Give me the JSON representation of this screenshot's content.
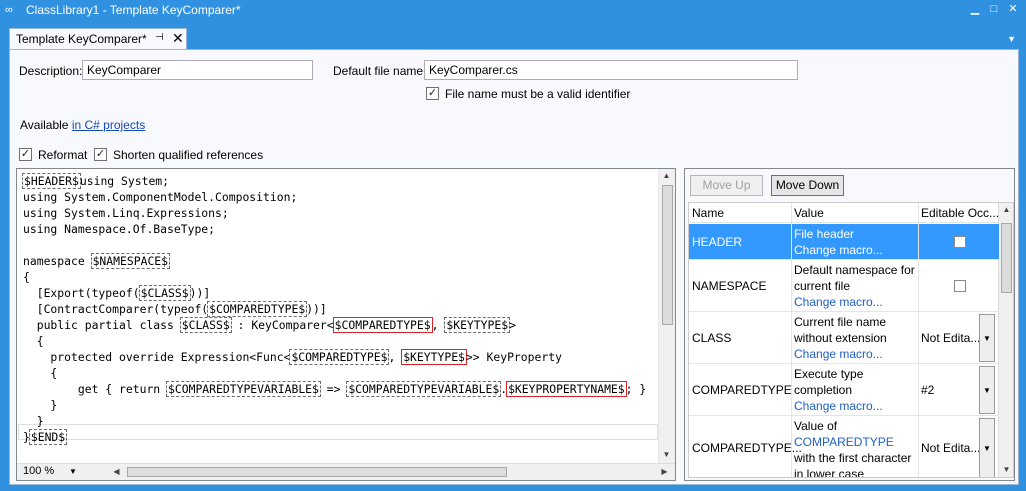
{
  "window": {
    "title": "ClassLibrary1 - Template KeyComparer*",
    "icon": "infinity-icon"
  },
  "tab": {
    "label": "Template KeyComparer*",
    "pin": "⊣",
    "close": "✕"
  },
  "form": {
    "description_label": "Description:",
    "description_value": "KeyComparer",
    "filename_label": "Default file name:",
    "filename_value": "KeyComparer.cs",
    "valid_identifier_label": "File name must be a valid identifier",
    "valid_identifier_checked": true,
    "available_prefix": "Available",
    "available_link": "in C# projects",
    "reformat_label": "Reformat",
    "reformat_checked": true,
    "shorten_label": "Shorten qualified references",
    "shorten_checked": true
  },
  "editor": {
    "zoom": "100 %",
    "code_lines": [
      "$HEADER$using System;",
      "using System.ComponentModel.Composition;",
      "using System.Linq.Expressions;",
      "using Namespace.Of.BaseType;",
      "",
      "namespace $NAMESPACE$",
      "{",
      "  [Export(typeof($CLASS$))]",
      "  [ContractComparer(typeof($COMPAREDTYPE$))]",
      "  public partial class $CLASS$ : KeyComparer<$COMPAREDTYPE$, $KEYTYPE$>",
      "  {",
      "    protected override Expression<Func<$COMPAREDTYPE$, $KEYTYPE$>> KeyProperty",
      "    {",
      "        get { return $COMPAREDTYPEVARIABLE$ => $COMPAREDTYPEVARIABLE$.$KEYPROPERTYNAME$; }",
      "    }",
      "  }",
      "}$END$"
    ]
  },
  "params": {
    "move_up": "Move Up",
    "move_down": "Move Down",
    "columns": [
      "Name",
      "Value",
      "Editable Occ..."
    ],
    "change_macro": "Change macro...",
    "rows": [
      {
        "name": "HEADER",
        "desc": "File header",
        "editable": "",
        "checkbox": true,
        "selected": true
      },
      {
        "name": "NAMESPACE",
        "desc": "Default namespace for current file",
        "editable": "",
        "checkbox": true,
        "selected": false
      },
      {
        "name": "CLASS",
        "desc": "Current file name without extension",
        "editable": "Not Edita...",
        "checkbox": false,
        "selected": false
      },
      {
        "name": "COMPAREDTYPE",
        "desc": "Execute type completion",
        "editable": "#2",
        "checkbox": false,
        "selected": false
      },
      {
        "name": "COMPAREDTYPE...",
        "desc_prefix": "Value of",
        "desc_link": "COMPAREDTYPE",
        "desc_suffix": "with the first character in lower case",
        "editable": "Not Edita...",
        "checkbox": false,
        "selected": false
      }
    ]
  }
}
